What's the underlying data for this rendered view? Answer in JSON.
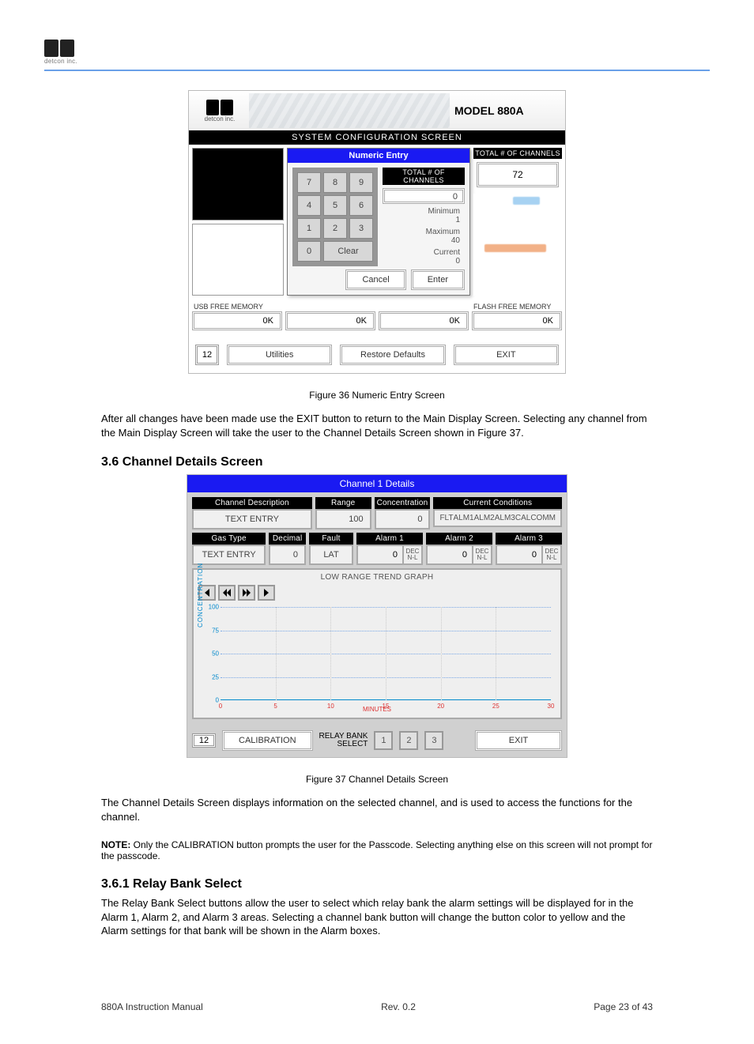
{
  "brand": {
    "name": "detcon inc."
  },
  "ss1": {
    "model": "MODEL 880A",
    "title_bar": "SYSTEM CONFIGURATION SCREEN",
    "popup": {
      "title": "Numeric Entry",
      "keys": [
        "7",
        "8",
        "9",
        "4",
        "5",
        "6",
        "1",
        "2",
        "3",
        "0"
      ],
      "clear": "Clear",
      "field_label": "TOTAL # OF CHANNELS",
      "field_value": "0",
      "min_label": "Minimum",
      "min_value": "1",
      "max_label": "Maximum",
      "max_value": "40",
      "cur_label": "Current",
      "cur_value": "0",
      "cancel": "Cancel",
      "enter": "Enter"
    },
    "right": {
      "label": "TOTAL # OF CHANNELS",
      "value": "72"
    },
    "mem": {
      "usb_label": "USB FREE MEMORY",
      "usb_value": "0K",
      "mid_value": "0K",
      "mid2_value": "0K",
      "flash_label": "FLASH FREE MEMORY",
      "flash_value": "0K"
    },
    "footer": {
      "chip": "12",
      "utilities": "Utilities",
      "restore": "Restore Defaults",
      "exit": "EXIT"
    }
  },
  "caption1": "Figure 36 Numeric Entry Screen",
  "para1": "After all changes have been made use the EXIT button to return to the Main Display Screen. Selecting any channel from the Main Display Screen will take the user to the Channel Details Screen shown in Figure 37.",
  "heading1": "3.6 Channel Details Screen",
  "ss2": {
    "title": "Channel 1 Details",
    "ch_desc_label": "Channel Description",
    "ch_desc_value": "TEXT ENTRY",
    "range_label": "Range",
    "range_value": "100",
    "conc_label": "Concentration",
    "conc_value": "0",
    "cond_label": "Current Conditions",
    "cond_flags": [
      "FLT",
      "ALM1",
      "ALM2",
      "ALM3",
      "CAL",
      "COMM"
    ],
    "gas_label": "Gas Type",
    "gas_value": "TEXT ENTRY",
    "dec_label": "Decimal",
    "dec_value": "0",
    "fault_label": "Fault",
    "fault_value": "LAT",
    "alarms": [
      {
        "label": "Alarm 1",
        "value": "0",
        "side1": "DEC",
        "side2": "N-L"
      },
      {
        "label": "Alarm 2",
        "value": "0",
        "side1": "DEC",
        "side2": "N-L"
      },
      {
        "label": "Alarm 3",
        "value": "0",
        "side1": "DEC",
        "side2": "N-L"
      }
    ],
    "trend_title": "LOW RANGE TREND GRAPH",
    "chip": "12",
    "calibration": "CALIBRATION",
    "relay_label": "RELAY BANK\nSELECT",
    "relay_buttons": [
      "1",
      "2",
      "3"
    ],
    "exit": "EXIT"
  },
  "chart_data": {
    "type": "line",
    "title": "LOW RANGE TREND GRAPH",
    "xlabel": "MINUTES",
    "ylabel": "CONCENTRATION",
    "x_ticks": [
      0,
      5,
      10,
      15,
      20,
      25,
      30
    ],
    "y_ticks": [
      0,
      25,
      50,
      75,
      100
    ],
    "xlim": [
      0,
      30
    ],
    "ylim": [
      0,
      100
    ],
    "series": [
      {
        "name": "Concentration",
        "x": [],
        "y": []
      }
    ]
  },
  "caption2": "Figure 37 Channel Details Screen",
  "para2": "The Channel Details Screen displays information on the selected channel, and is used to access the functions for the channel.",
  "note_label": "NOTE:",
  "note_text": " Only the CALIBRATION button prompts the user for the Passcode. Selecting anything else on this screen will not prompt for the passcode.",
  "heading2": "3.6.1 Relay Bank Select",
  "para3": "The Relay Bank Select buttons allow the user to select which relay bank the alarm settings will be displayed for in the Alarm 1, Alarm 2, and Alarm 3 areas. Selecting a channel bank button will change the button color to yellow and the Alarm settings for that bank will be shown in the Alarm boxes.",
  "page_footer": {
    "left": "880A Instruction Manual",
    "right": "Rev. 0.2",
    "page": "Page 23 of 43"
  }
}
